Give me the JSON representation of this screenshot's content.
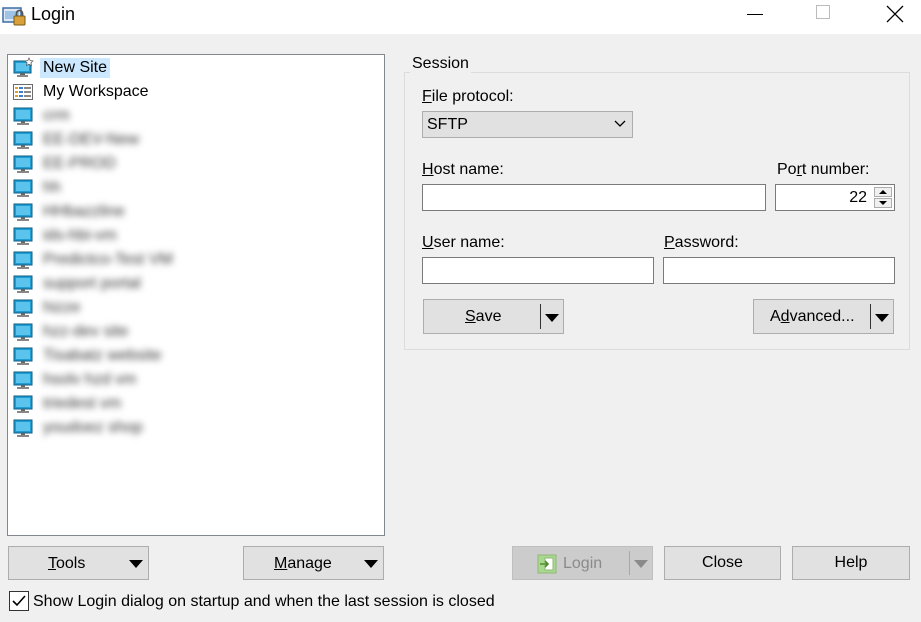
{
  "window": {
    "title": "Login",
    "icon": "winscp-login-icon",
    "controls": [
      "minimize-icon",
      "maximize-icon",
      "close-icon"
    ]
  },
  "sites": {
    "items": [
      {
        "label": "New Site",
        "icon": "new-site-icon",
        "selected": true,
        "blurred": false
      },
      {
        "label": "My Workspace",
        "icon": "workspace-icon",
        "selected": false,
        "blurred": false
      },
      {
        "label": "crm",
        "icon": "monitor-icon",
        "blurred": true
      },
      {
        "label": "EE-DEV-New",
        "icon": "monitor-icon",
        "blurred": true
      },
      {
        "label": "EE-PROD",
        "icon": "monitor-icon",
        "blurred": true
      },
      {
        "label": "hh",
        "icon": "monitor-icon",
        "blurred": true
      },
      {
        "label": "HHbazzline",
        "icon": "monitor-icon",
        "blurred": true
      },
      {
        "label": "ids-hbi-vm",
        "icon": "monitor-icon",
        "blurred": true
      },
      {
        "label": "Predictco-Test VM",
        "icon": "monitor-icon",
        "blurred": true
      },
      {
        "label": "support portal",
        "icon": "monitor-icon",
        "blurred": true
      },
      {
        "label": "hizze",
        "icon": "monitor-icon",
        "blurred": true
      },
      {
        "label": "hzz-dev site",
        "icon": "monitor-icon",
        "blurred": true
      },
      {
        "label": "Tisabatz website",
        "icon": "monitor-icon",
        "blurred": true
      },
      {
        "label": "hsolv hzd vm",
        "icon": "monitor-icon",
        "blurred": true
      },
      {
        "label": "triedest vm",
        "icon": "monitor-icon",
        "blurred": true
      },
      {
        "label": "youdoez shop",
        "icon": "monitor-icon",
        "blurred": true
      }
    ]
  },
  "session": {
    "legend": "Session",
    "file_protocol_label": "File protocol:",
    "file_protocol_value": "SFTP",
    "host_label": "Host name:",
    "host_value": "",
    "port_label": "Port number:",
    "port_value": "22",
    "user_label": "User name:",
    "user_value": "",
    "password_label": "Password:",
    "password_value": "",
    "save_label": "Save",
    "advanced_label": "Advanced..."
  },
  "bottom": {
    "tools_label": "Tools",
    "manage_label": "Manage",
    "login_label": "Login",
    "close_label": "Close",
    "help_label": "Help",
    "startup_checkbox_label": "Show Login dialog on startup and when the last session is closed",
    "startup_checkbox_checked": true
  },
  "colors": {
    "selection": "#cce8ff",
    "monitor_blue": "#1e9fd4",
    "login_icon_green": "#6cbf3f"
  }
}
